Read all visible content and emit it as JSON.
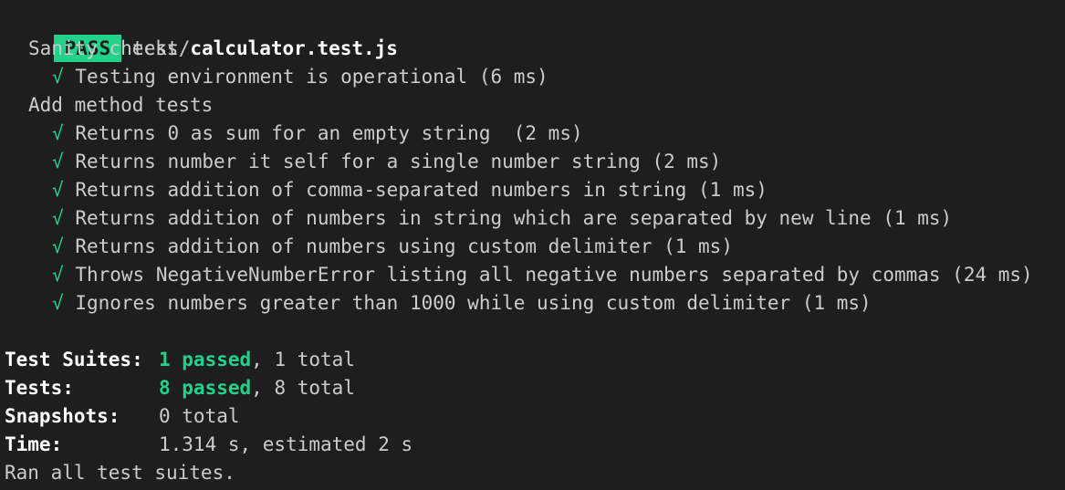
{
  "header": {
    "badge": "PASS",
    "file_dir": "test/",
    "file_name": "calculator.test.js"
  },
  "check_symbol": "√",
  "suites": [
    {
      "title": "Sanity checks",
      "tests": [
        "Testing environment is operational (6 ms)"
      ]
    },
    {
      "title": "Add method tests",
      "tests": [
        "Returns 0 as sum for an empty string  (2 ms)",
        "Returns number it self for a single number string (2 ms)",
        "Returns addition of comma-separated numbers in string (1 ms)",
        "Returns addition of numbers in string which are separated by new line (1 ms)",
        "Returns addition of numbers using custom delimiter (1 ms)",
        "Throws NegativeNumberError listing all negative numbers separated by commas (24 ms)",
        "Ignores numbers greater than 1000 while using custom delimiter (1 ms)"
      ]
    }
  ],
  "summary": {
    "suites_label": "Test Suites:",
    "suites_passed": "1 passed",
    "suites_total": ", 1 total",
    "tests_label": "Tests:",
    "tests_passed": "8 passed",
    "tests_total": ", 8 total",
    "snapshots_label": "Snapshots:",
    "snapshots_value": "0 total",
    "time_label": "Time:",
    "time_value": "1.314 s, estimated 2 s",
    "footer": "Ran all test suites."
  },
  "colors": {
    "background": "#1e1e1e",
    "text": "#cccccc",
    "pass_green": "#23d18b"
  }
}
